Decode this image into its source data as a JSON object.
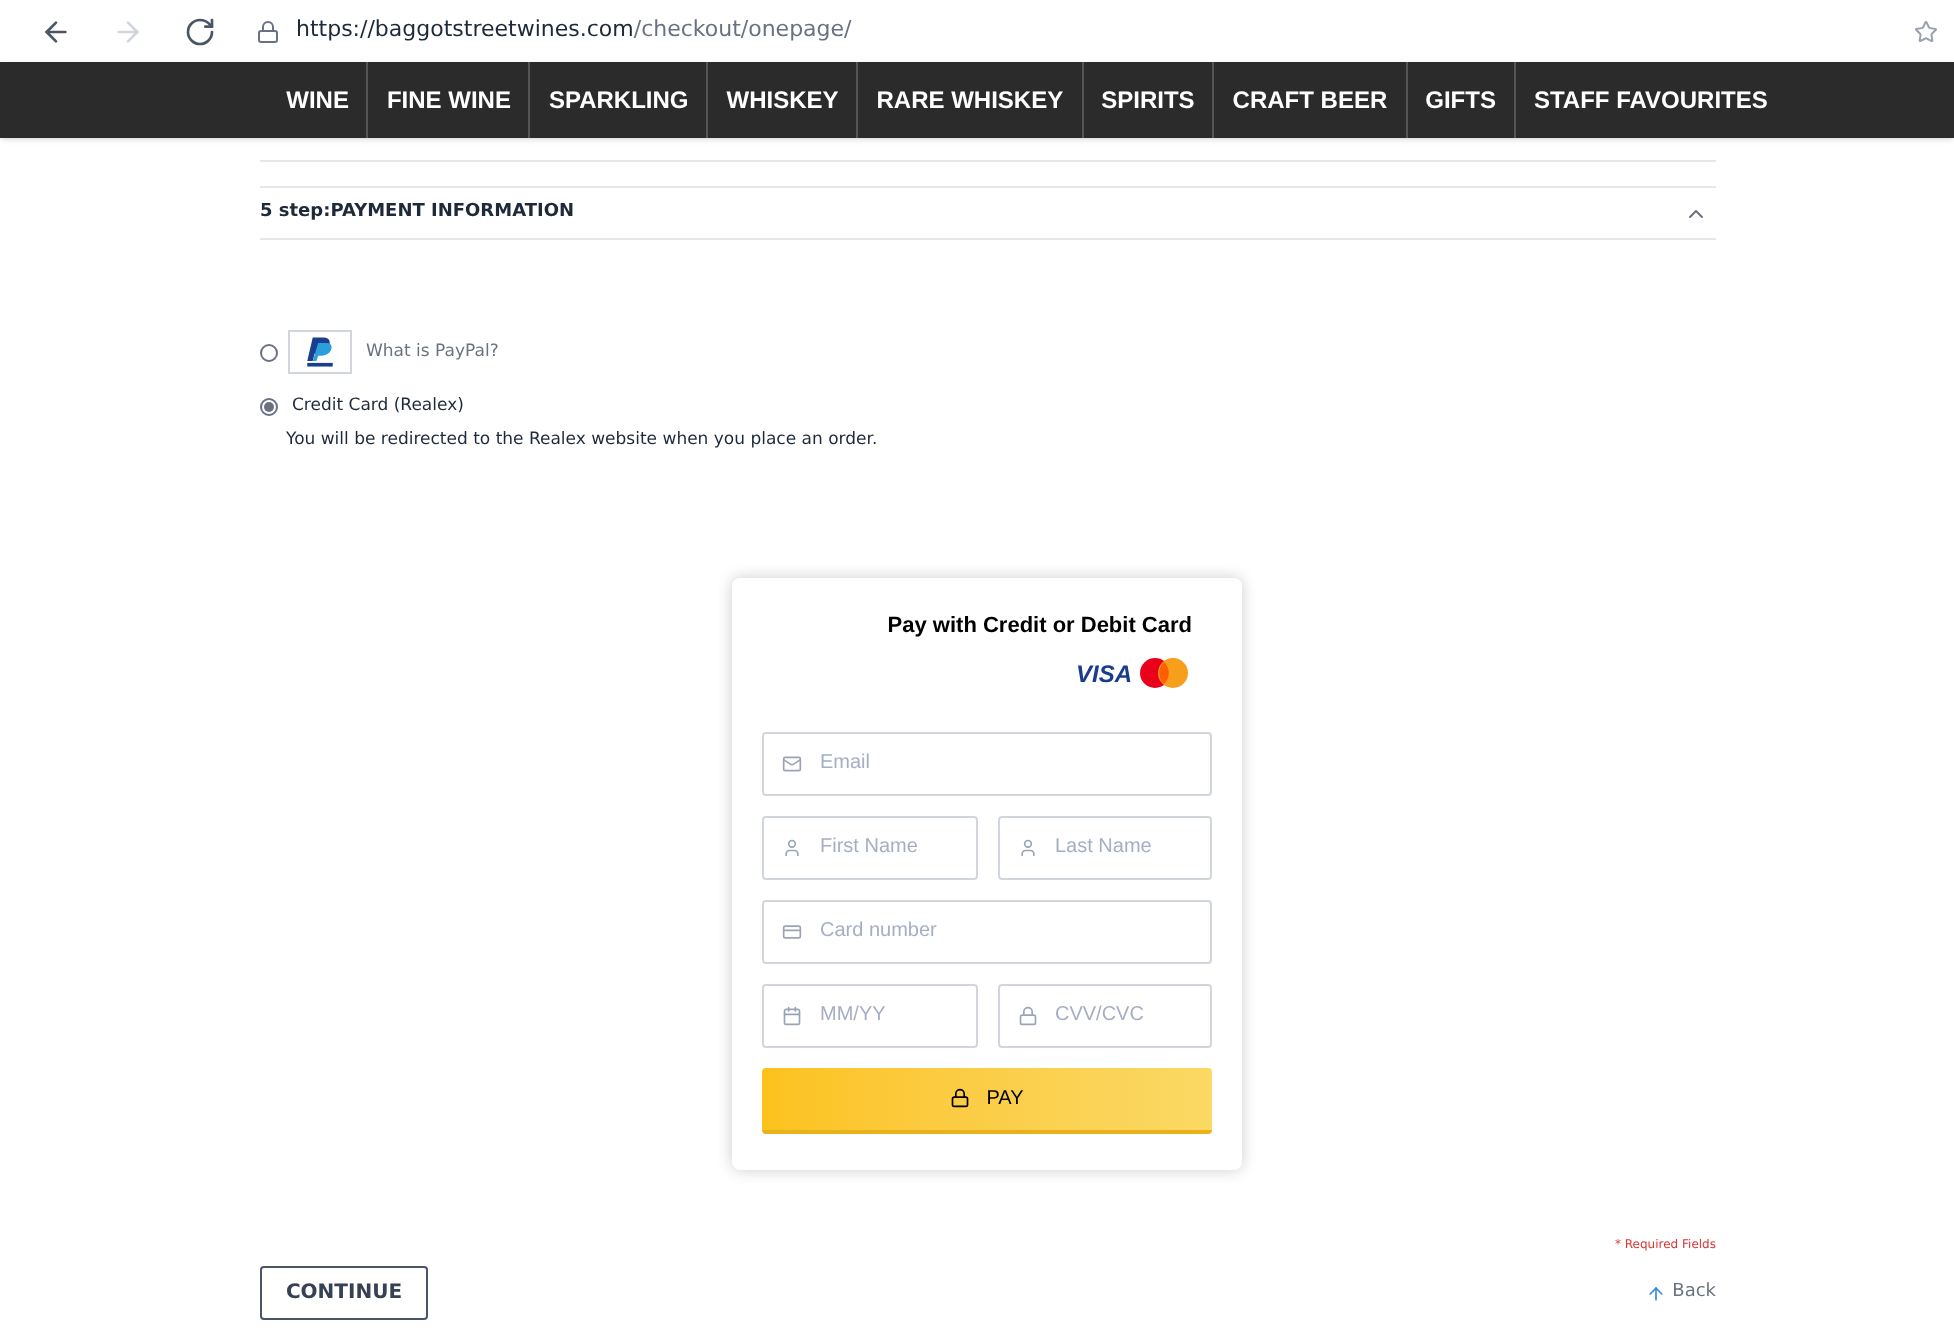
{
  "browser": {
    "url_host": "https://baggotstreetwines.com",
    "url_path": "/checkout/onepage/"
  },
  "nav": [
    "WINE",
    "FINE WINE",
    "SPARKLING",
    "WHISKEY",
    "RARE WHISKEY",
    "SPIRITS",
    "CRAFT BEER",
    "GIFTS",
    "STAFF FAVOURITES"
  ],
  "step": {
    "title": "5 step:PAYMENT INFORMATION",
    "expanded": true
  },
  "payment_methods": [
    {
      "kind": "paypal",
      "label": "What is PayPal?",
      "selected": false
    },
    {
      "kind": "card",
      "label": "Credit Card (Realex)",
      "note": "You will be redirected to the Realex website when you place an order.",
      "selected": true
    }
  ],
  "card_form": {
    "title": "Pay with Credit or Debit Card",
    "visa": "VISA",
    "rows": [
      [
        {
          "kind": "email",
          "placeholder": "Email"
        }
      ],
      [
        {
          "kind": "name",
          "placeholder": "First Name"
        },
        {
          "kind": "name",
          "placeholder": "Last Name"
        }
      ],
      [
        {
          "kind": "card",
          "placeholder": "Card number"
        }
      ],
      [
        {
          "kind": "expiry",
          "placeholder": "MM/YY"
        },
        {
          "kind": "cvv",
          "placeholder": "CVV/CVC"
        }
      ]
    ],
    "pay_button": "PAY"
  },
  "required_note": "* Required Fields",
  "continue_button": "CONTINUE",
  "back_link": "Back"
}
